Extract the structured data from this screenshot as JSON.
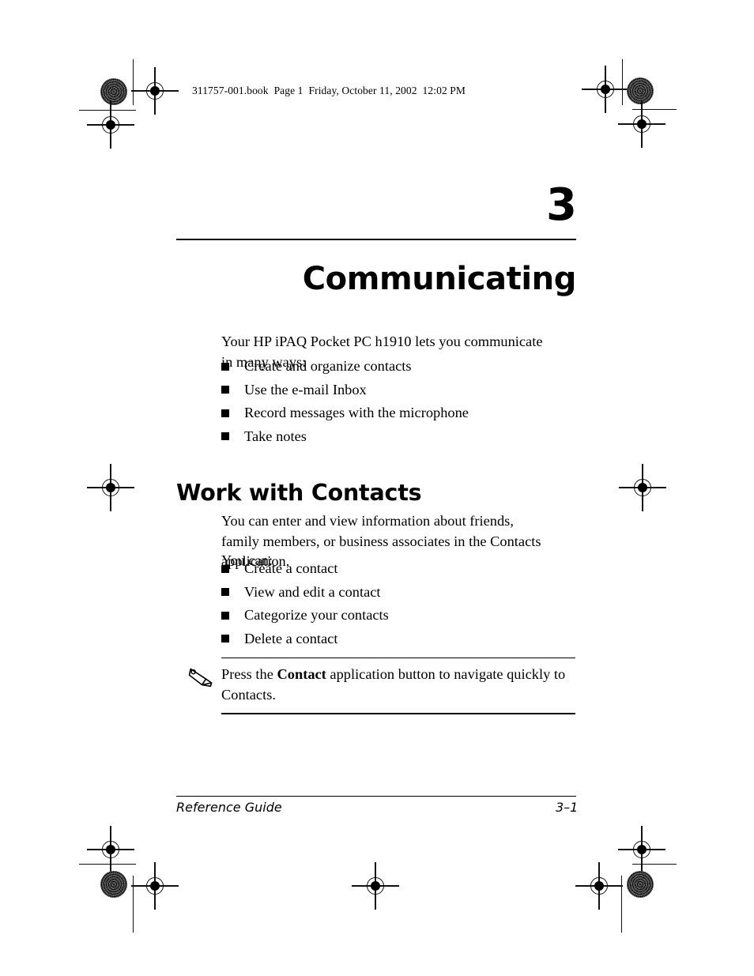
{
  "document": {
    "header_line": "311757-001.book  Page 1  Friday, October 11, 2002  12:02 PM",
    "chapter_number": "3",
    "chapter_title": "Communicating",
    "intro_paragraph": "Your HP iPAQ Pocket PC h1910 lets you communicate in many ways:",
    "intro_bullets": [
      {
        "text": "Create and organize contacts"
      },
      {
        "text": "Use the e-mail Inbox"
      },
      {
        "text": "Record messages with the microphone"
      },
      {
        "text": "Take notes"
      }
    ],
    "section": {
      "heading": "Work with Contacts",
      "paragraph_1": "You can enter and view information about friends, family members, or business associates in the Contacts application.",
      "paragraph_2": "You can:",
      "bullets": [
        {
          "text": "Create a contact"
        },
        {
          "text": "View and edit a contact"
        },
        {
          "text": "Categorize your contacts"
        },
        {
          "text": "Delete a contact"
        }
      ]
    },
    "note": {
      "icon": "pencil-note-icon",
      "text_before": "Press the ",
      "emphasis": "Contact",
      "text_after": " application button to navigate quickly to Contacts."
    },
    "footer": {
      "left": "Reference Guide",
      "right": "3–1"
    }
  },
  "print_marks": {
    "registration_icon": "registration-crosshair-icon",
    "halftone_icon": "halftone-dot-icon"
  },
  "colors": {
    "ink": "#000000",
    "paper": "#ffffff",
    "mark_gray": "#7c7c7c"
  }
}
